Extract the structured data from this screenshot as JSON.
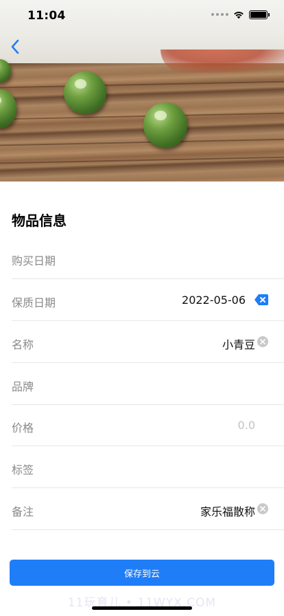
{
  "status_bar": {
    "time": "11:04"
  },
  "icons": {
    "back": "chevron-left-icon",
    "clear": "clear-circle-icon",
    "delete": "delete-backward-icon"
  },
  "colors": {
    "accent": "#1f7df8",
    "label": "#8a8a8a",
    "placeholder": "#c2c2c2",
    "divider": "#e6e6e6"
  },
  "form": {
    "title": "物品信息",
    "fields": [
      {
        "label": "购买日期",
        "value": "",
        "placeholder": ""
      },
      {
        "label": "保质日期",
        "value": "2022-05-06",
        "placeholder": ""
      },
      {
        "label": "名称",
        "value": "小青豆",
        "placeholder": ""
      },
      {
        "label": "品牌",
        "value": "",
        "placeholder": ""
      },
      {
        "label": "价格",
        "value": "",
        "placeholder": "0.0"
      },
      {
        "label": "标签",
        "value": "",
        "placeholder": ""
      },
      {
        "label": "备注",
        "value": "家乐福散称",
        "placeholder": ""
      }
    ]
  },
  "save_button": {
    "label": "保存到云"
  },
  "watermark": "11玩育儿 • 11WYX.COM"
}
